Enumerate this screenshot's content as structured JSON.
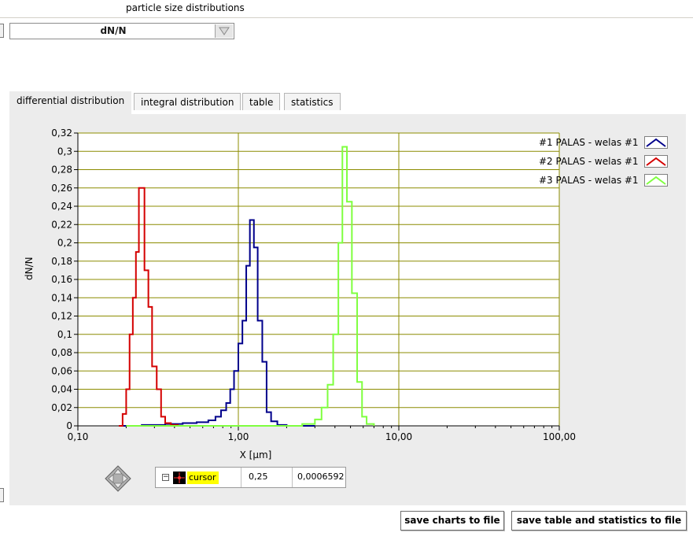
{
  "window": {
    "title": "particle size distributions"
  },
  "distribution_select": {
    "value": "dN/N"
  },
  "tabs": [
    {
      "label": "differential distribution",
      "active": true
    },
    {
      "label": "integral distribution",
      "active": false
    },
    {
      "label": "table",
      "active": false
    },
    {
      "label": "statistics",
      "active": false
    }
  ],
  "legend": [
    {
      "label": "#1 PALAS - welas #1",
      "color": "#00008b"
    },
    {
      "label": "#2 PALAS - welas #1",
      "color": "#d40000"
    },
    {
      "label": "#3 PALAS - welas #1",
      "color": "#7fff3f"
    }
  ],
  "cursor": {
    "name": "cursor",
    "x": "0,25",
    "y": "0,0006592"
  },
  "buttons": {
    "save_charts": "save charts to file",
    "save_table": "save table and statistics to file"
  },
  "chart_data": {
    "type": "line",
    "title": "",
    "xlabel": "X [µm]",
    "ylabel": "dN/N",
    "x_scale": "log",
    "xlim": [
      0.1,
      100
    ],
    "ylim": [
      0,
      0.32
    ],
    "x_tick_labels": [
      "0,10",
      "1,00",
      "10,00",
      "100,00"
    ],
    "y_tick_labels": [
      "0",
      "0,02",
      "0,04",
      "0,06",
      "0,08",
      "0,1",
      "0,12",
      "0,14",
      "0,16",
      "0,18",
      "0,2",
      "0,22",
      "0,24",
      "0,26",
      "0,28",
      "0,3",
      "0,32"
    ],
    "grid": true,
    "legend_position": "top-right",
    "series": [
      {
        "name": "#1 PALAS - welas #1",
        "color": "#00008b",
        "x": [
          0.18,
          0.25,
          0.35,
          0.45,
          0.55,
          0.65,
          0.72,
          0.78,
          0.84,
          0.89,
          0.94,
          1.0,
          1.06,
          1.12,
          1.18,
          1.25,
          1.32,
          1.41,
          1.5,
          1.6,
          1.75,
          2.0,
          3.0
        ],
        "values": [
          0.0,
          0.001,
          0.002,
          0.003,
          0.004,
          0.006,
          0.01,
          0.017,
          0.025,
          0.04,
          0.06,
          0.09,
          0.115,
          0.175,
          0.225,
          0.195,
          0.115,
          0.07,
          0.015,
          0.005,
          0.001,
          0.0,
          0.0
        ]
      },
      {
        "name": "#2 PALAS - welas #1",
        "color": "#d40000",
        "x": [
          0.18,
          0.19,
          0.2,
          0.21,
          0.22,
          0.23,
          0.24,
          0.25,
          0.26,
          0.275,
          0.29,
          0.31,
          0.33,
          0.35,
          0.38,
          0.42,
          0.6,
          1.5
        ],
        "values": [
          0.0,
          0.013,
          0.04,
          0.1,
          0.14,
          0.19,
          0.26,
          0.26,
          0.17,
          0.13,
          0.065,
          0.04,
          0.01,
          0.003,
          0.001,
          0.0,
          0.0,
          0.0
        ]
      },
      {
        "name": "#3 PALAS - welas #1",
        "color": "#7fff3f",
        "x": [
          0.2,
          1.5,
          2.5,
          3.0,
          3.3,
          3.6,
          3.9,
          4.2,
          4.45,
          4.75,
          5.1,
          5.5,
          5.9,
          6.3,
          7.0
        ],
        "values": [
          0.0,
          0.0,
          0.002,
          0.007,
          0.02,
          0.045,
          0.1,
          0.2,
          0.305,
          0.245,
          0.145,
          0.048,
          0.01,
          0.002,
          0.0
        ]
      }
    ]
  }
}
